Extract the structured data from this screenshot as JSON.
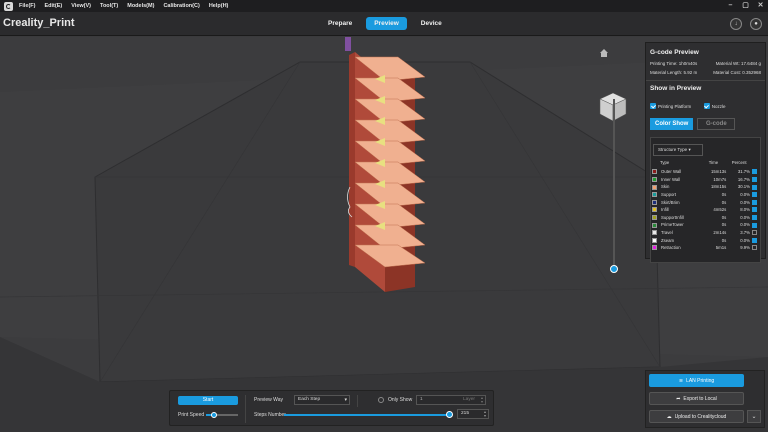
{
  "menubar": {
    "items": [
      "File(F)",
      "Edit(E)",
      "View(V)",
      "Tool(T)",
      "Models(M)",
      "Calibration(C)",
      "Help(H)"
    ]
  },
  "app": {
    "title": "Creality_Print"
  },
  "tabs": [
    {
      "label": "Prepare",
      "active": false
    },
    {
      "label": "Preview",
      "active": true
    },
    {
      "label": "Device",
      "active": false
    }
  ],
  "gcode_preview": {
    "title": "G-code Preview",
    "printing_time_label": "Printing Time:",
    "printing_time": "1h0m40s",
    "material_wt_label": "Material Wt:",
    "material_wt": "17.6484 g",
    "material_length_label": "Material Length:",
    "material_length": "5.92 m",
    "material_cost_label": "Material Cost:",
    "material_cost": "0.352968",
    "show_in_preview": "Show in Preview",
    "printing_platform": "Printing Platform",
    "nozzle": "Nozzle",
    "color_show": "Color Show",
    "gcode": "G-code",
    "structure_type": "Structure Type",
    "col_type": "Type",
    "col_time": "Time",
    "col_percent": "Percent",
    "rows": [
      {
        "type": "Outer Wall",
        "time": "15m13s",
        "percent": "31.7%",
        "color": "#8a1c1c",
        "checked": true
      },
      {
        "type": "Inner Wall",
        "time": "10m7s",
        "percent": "16.7%",
        "color": "#1f9a2e",
        "checked": true
      },
      {
        "type": "Skin",
        "time": "18m15s",
        "percent": "30.1%",
        "color": "#f0a070",
        "checked": true
      },
      {
        "type": "Support",
        "time": "0s",
        "percent": "0.0%",
        "color": "#1a9a9a",
        "checked": true
      },
      {
        "type": "Skirt/Brim",
        "time": "0s",
        "percent": "0.0%",
        "color": "#1c2f7a",
        "checked": true
      },
      {
        "type": "Infill",
        "time": "4m52s",
        "percent": "8.0%",
        "color": "#e0c020",
        "checked": true
      },
      {
        "type": "SupportInfill",
        "time": "0s",
        "percent": "0.0%",
        "color": "#a0a020",
        "checked": true
      },
      {
        "type": "PrimeTower",
        "time": "0s",
        "percent": "0.0%",
        "color": "#2a8a3a",
        "checked": true
      },
      {
        "type": "Travel",
        "time": "2m14s",
        "percent": "3.7%",
        "color": "#e8e8e8",
        "checked": false
      },
      {
        "type": "Zseam",
        "time": "0s",
        "percent": "0.0%",
        "color": "#ffffff",
        "checked": true
      },
      {
        "type": "Retraction",
        "time": "5m1s",
        "percent": "9.9%",
        "color": "#e020e0",
        "checked": false
      }
    ]
  },
  "bottom": {
    "start": "Start",
    "print_speed": "Print Speed",
    "print_speed_level": 0.25,
    "preview_way": "Preview Way",
    "preview_way_value": "Each Step",
    "only_show": "Only Show",
    "only_show_value": "1",
    "layer": "Layer",
    "steps_number": "Steps Number",
    "steps_value": "215"
  },
  "export": {
    "lan": "LAN Printing",
    "local": "Export to Local",
    "cloud": "Upload to Crealitycloud"
  },
  "colors": {
    "accent": "#1a9bdf",
    "wall": "#b04a3a",
    "skin": "#f0b090"
  }
}
